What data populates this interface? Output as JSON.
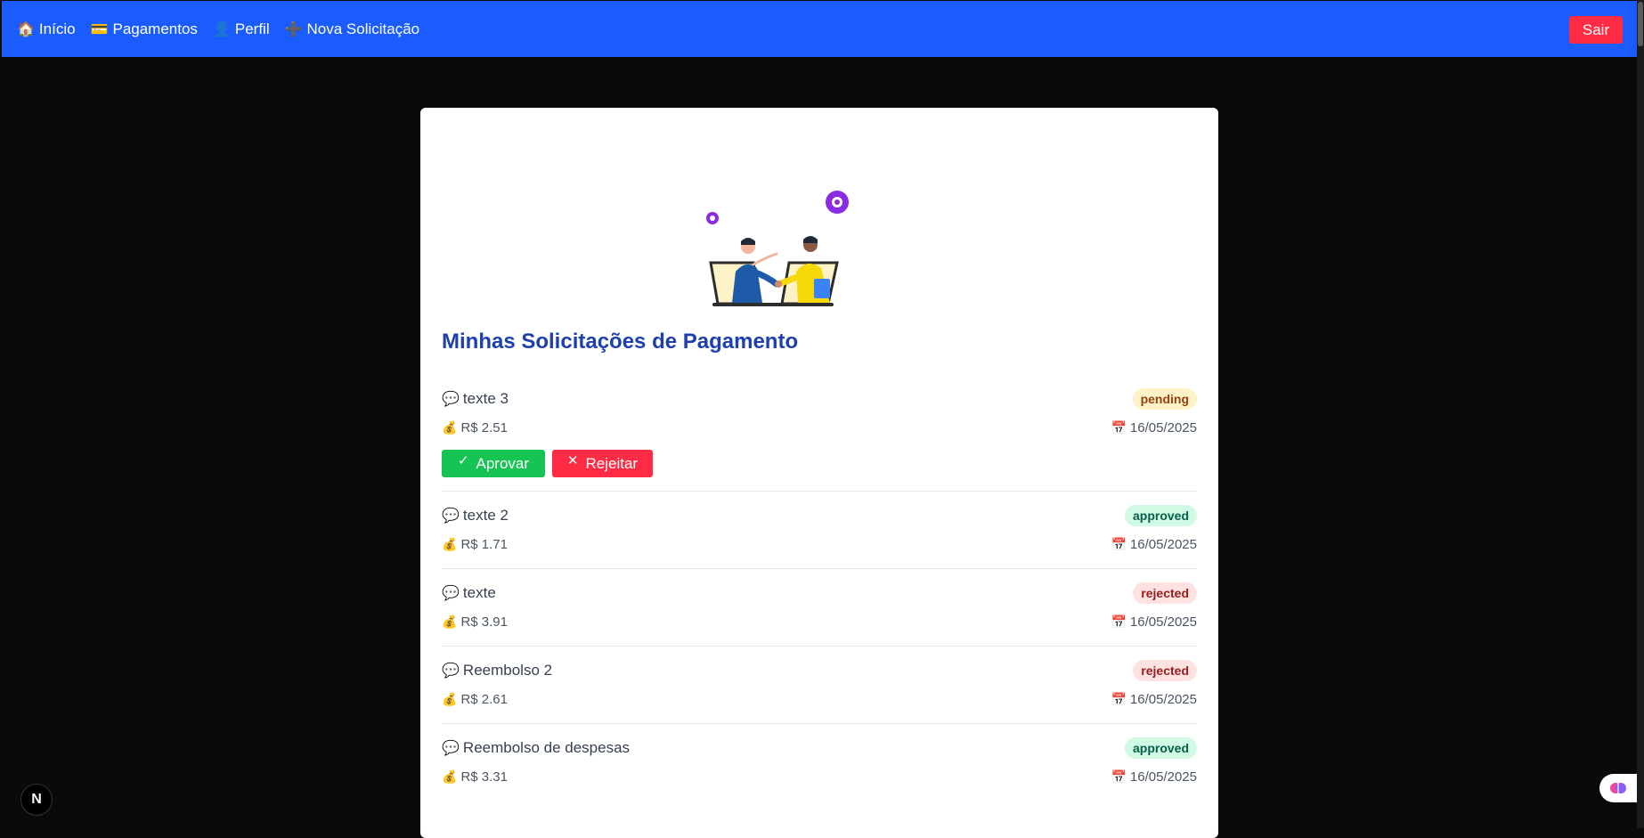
{
  "nav": {
    "items": [
      {
        "icon": "🏠",
        "icon_name": "home-icon",
        "label": "Início"
      },
      {
        "icon": "💳",
        "icon_name": "credit-card-icon",
        "label": "Pagamentos"
      },
      {
        "icon": "👤",
        "icon_name": "user-icon",
        "label": "Perfil"
      },
      {
        "icon": "➕",
        "icon_name": "plus-icon",
        "label": "Nova Solicitação"
      }
    ],
    "logout_label": "Sair"
  },
  "page": {
    "title": "Minhas Solicitações de Pagamento"
  },
  "icons": {
    "message": "💬",
    "money": "💰",
    "calendar": "📅",
    "check": "✓",
    "cross": "✕"
  },
  "actions": {
    "approve_label": "Aprovar",
    "reject_label": "Rejeitar"
  },
  "requests": [
    {
      "title": "texte 3",
      "amount": "R$ 2.51",
      "date": "16/05/2025",
      "status": "pending"
    },
    {
      "title": "texte 2",
      "amount": "R$ 1.71",
      "date": "16/05/2025",
      "status": "approved"
    },
    {
      "title": "texte",
      "amount": "R$ 3.91",
      "date": "16/05/2025",
      "status": "rejected"
    },
    {
      "title": "Reembolso 2",
      "amount": "R$ 2.61",
      "date": "16/05/2025",
      "status": "rejected"
    },
    {
      "title": "Reembolso de despesas",
      "amount": "R$ 3.31",
      "date": "16/05/2025",
      "status": "approved"
    }
  ],
  "colors": {
    "navbar": "#1a5cff",
    "title": "#1e40af",
    "approve": "#16c454",
    "reject": "#ff2b45"
  },
  "dev_badge_letter": "N"
}
